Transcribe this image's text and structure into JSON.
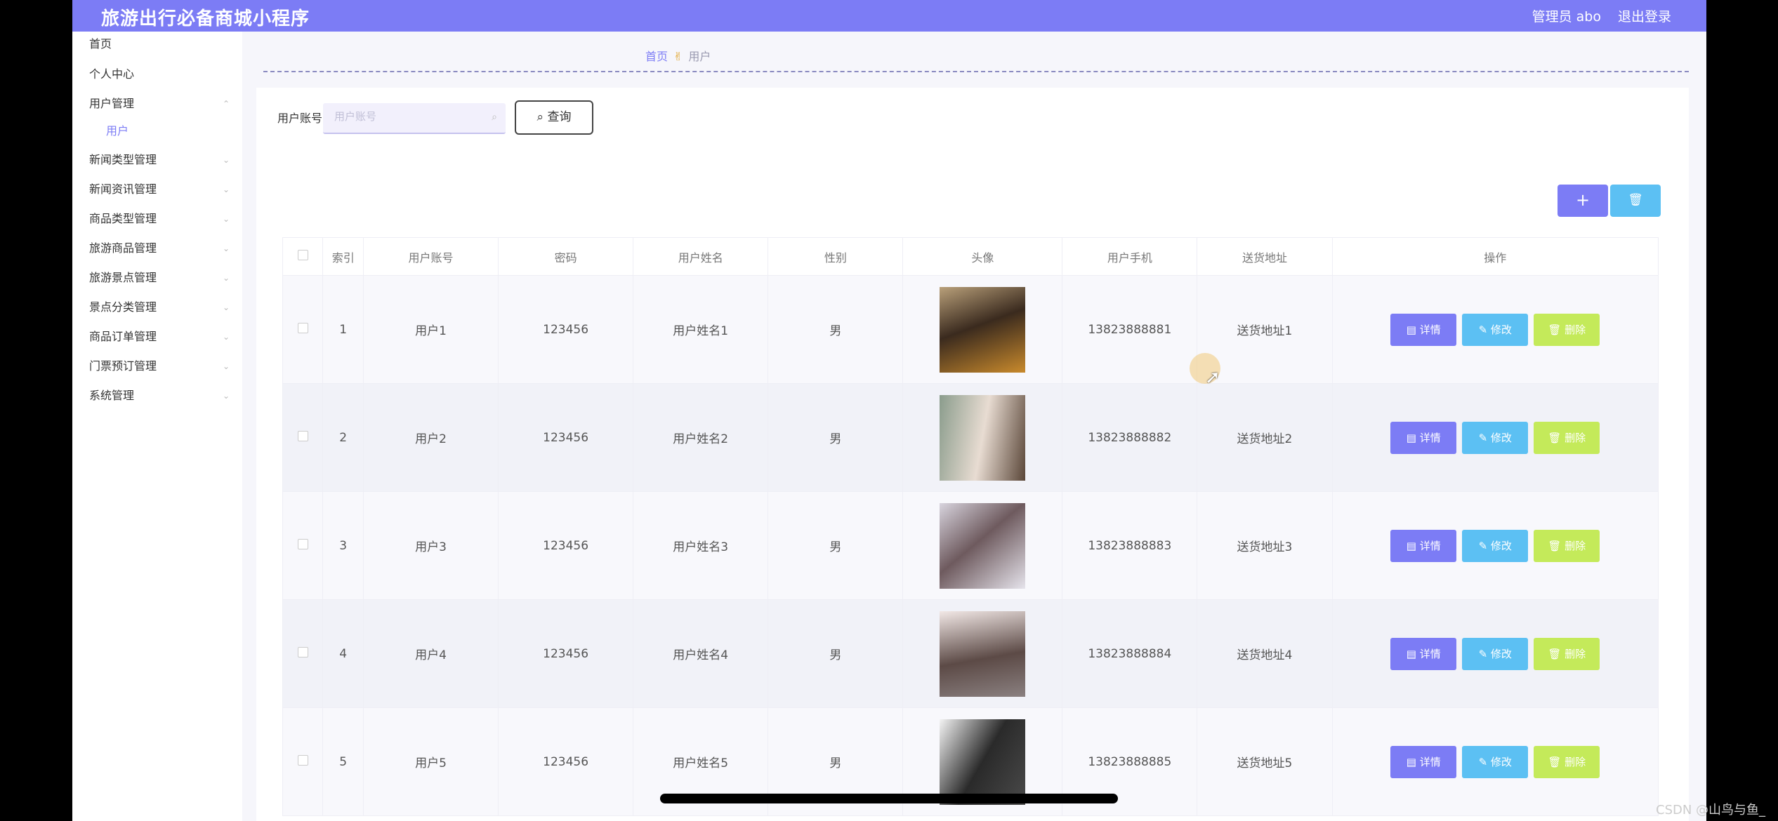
{
  "app": {
    "title": "旅游出行必备商城小程序",
    "admin": "管理员 abo",
    "logout": "退出登录"
  },
  "sidebar": {
    "items": [
      {
        "label": "首页",
        "expandable": false
      },
      {
        "label": "个人中心",
        "expandable": false
      },
      {
        "label": "用户管理",
        "expandable": true
      },
      {
        "label": "用户",
        "sub": true
      },
      {
        "label": "新闻类型管理",
        "expandable": true
      },
      {
        "label": "新闻资讯管理",
        "expandable": true
      },
      {
        "label": "商品类型管理",
        "expandable": true
      },
      {
        "label": "旅游商品管理",
        "expandable": true
      },
      {
        "label": "旅游景点管理",
        "expandable": true
      },
      {
        "label": "景点分类管理",
        "expandable": true
      },
      {
        "label": "商品订单管理",
        "expandable": true
      },
      {
        "label": "门票预订管理",
        "expandable": true
      },
      {
        "label": "系统管理",
        "expandable": true
      }
    ]
  },
  "breadcrumb": {
    "home": "首页",
    "current": "用户"
  },
  "search": {
    "label": "用户账号",
    "placeholder": "用户账号",
    "button": "查询"
  },
  "toolbar": {
    "add": "+",
    "delete": "🗑"
  },
  "table": {
    "headers": [
      "索引",
      "用户账号",
      "密码",
      "用户姓名",
      "性别",
      "头像",
      "用户手机",
      "送货地址",
      "操作"
    ],
    "rows": [
      {
        "index": "1",
        "account": "用户1",
        "password": "123456",
        "name": "用户姓名1",
        "gender": "男",
        "phone": "13823888881",
        "address": "送货地址1"
      },
      {
        "index": "2",
        "account": "用户2",
        "password": "123456",
        "name": "用户姓名2",
        "gender": "男",
        "phone": "13823888882",
        "address": "送货地址2"
      },
      {
        "index": "3",
        "account": "用户3",
        "password": "123456",
        "name": "用户姓名3",
        "gender": "男",
        "phone": "13823888883",
        "address": "送货地址3"
      },
      {
        "index": "4",
        "account": "用户4",
        "password": "123456",
        "name": "用户姓名4",
        "gender": "男",
        "phone": "13823888884",
        "address": "送货地址4"
      },
      {
        "index": "5",
        "account": "用户5",
        "password": "123456",
        "name": "用户姓名5",
        "gender": "男",
        "phone": "13823888885",
        "address": "送货地址5"
      }
    ],
    "actions": {
      "detail": "详情",
      "edit": "修改",
      "delete": "删除"
    }
  },
  "watermark": "CSDN @山鸟与鱼_",
  "colors": {
    "accent": "#7c7cf5",
    "edit": "#5cc0f3",
    "delete": "#c4ea5a"
  }
}
